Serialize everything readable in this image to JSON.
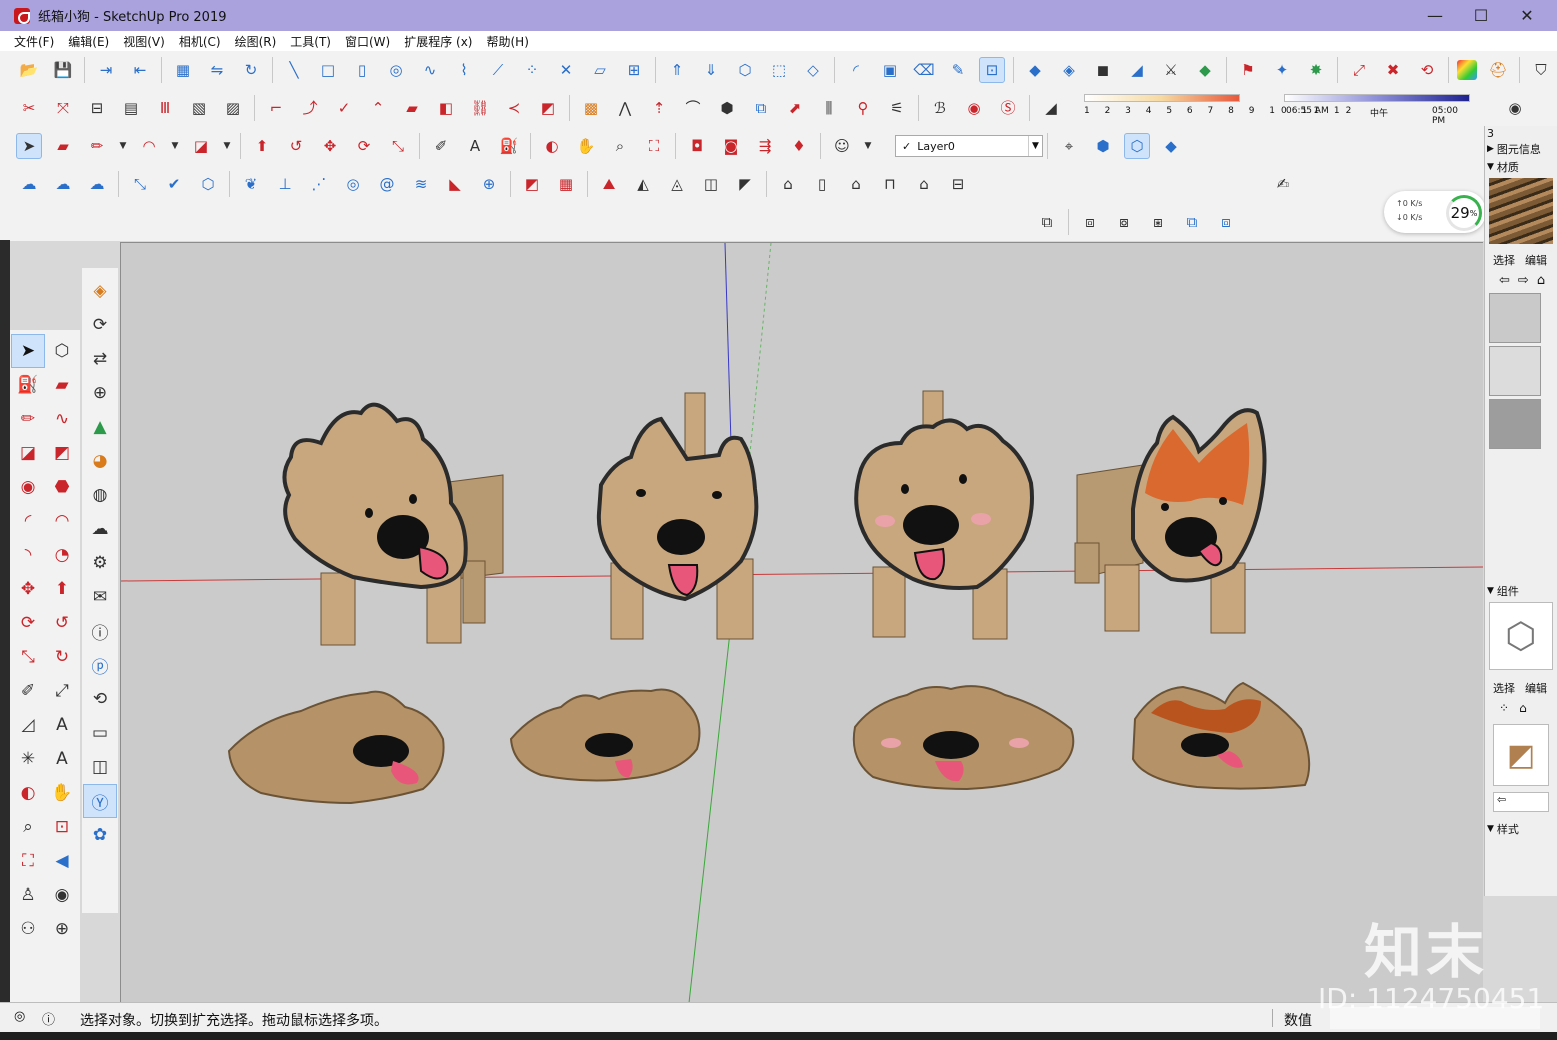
{
  "window": {
    "title": "纸箱小狗 - SketchUp Pro 2019",
    "minimize": "—",
    "maximize": "☐",
    "close": "✕"
  },
  "menu": [
    "文件(F)",
    "编辑(E)",
    "视图(V)",
    "相机(C)",
    "绘图(R)",
    "工具(T)",
    "窗口(W)",
    "扩展程序 (x)",
    "帮助(H)"
  ],
  "layer": {
    "value": "Layer0",
    "check": "✓"
  },
  "shadow": {
    "months": "1 2 3 4 5 6 7 8 9 10 11 12",
    "time_start": "06:55 AM",
    "time_mid": "中午",
    "time_end": "05:00 PM"
  },
  "network": {
    "up": "↑0  K/s",
    "down": "↓0  K/s",
    "percent": "29",
    "percent_unit": "%"
  },
  "right_panel": {
    "number": "3",
    "entity_info": "图元信息",
    "materials": "材质",
    "components": "组件",
    "tabs_select": "选择",
    "tabs_edit": "编辑",
    "styles": "样式"
  },
  "status": {
    "hint": "选择对象。切换到扩充选择。拖动鼠标选择多项。",
    "value_label": "数值"
  },
  "watermark": {
    "logo": "知末",
    "id": "ID: 1124750451"
  },
  "colors": {
    "accent_title": "#a9a2dc",
    "cardboard": "#c9a77e",
    "sky": "#cbcbcb",
    "tongue": "#e8577a",
    "fur_orange": "#d9692e"
  }
}
